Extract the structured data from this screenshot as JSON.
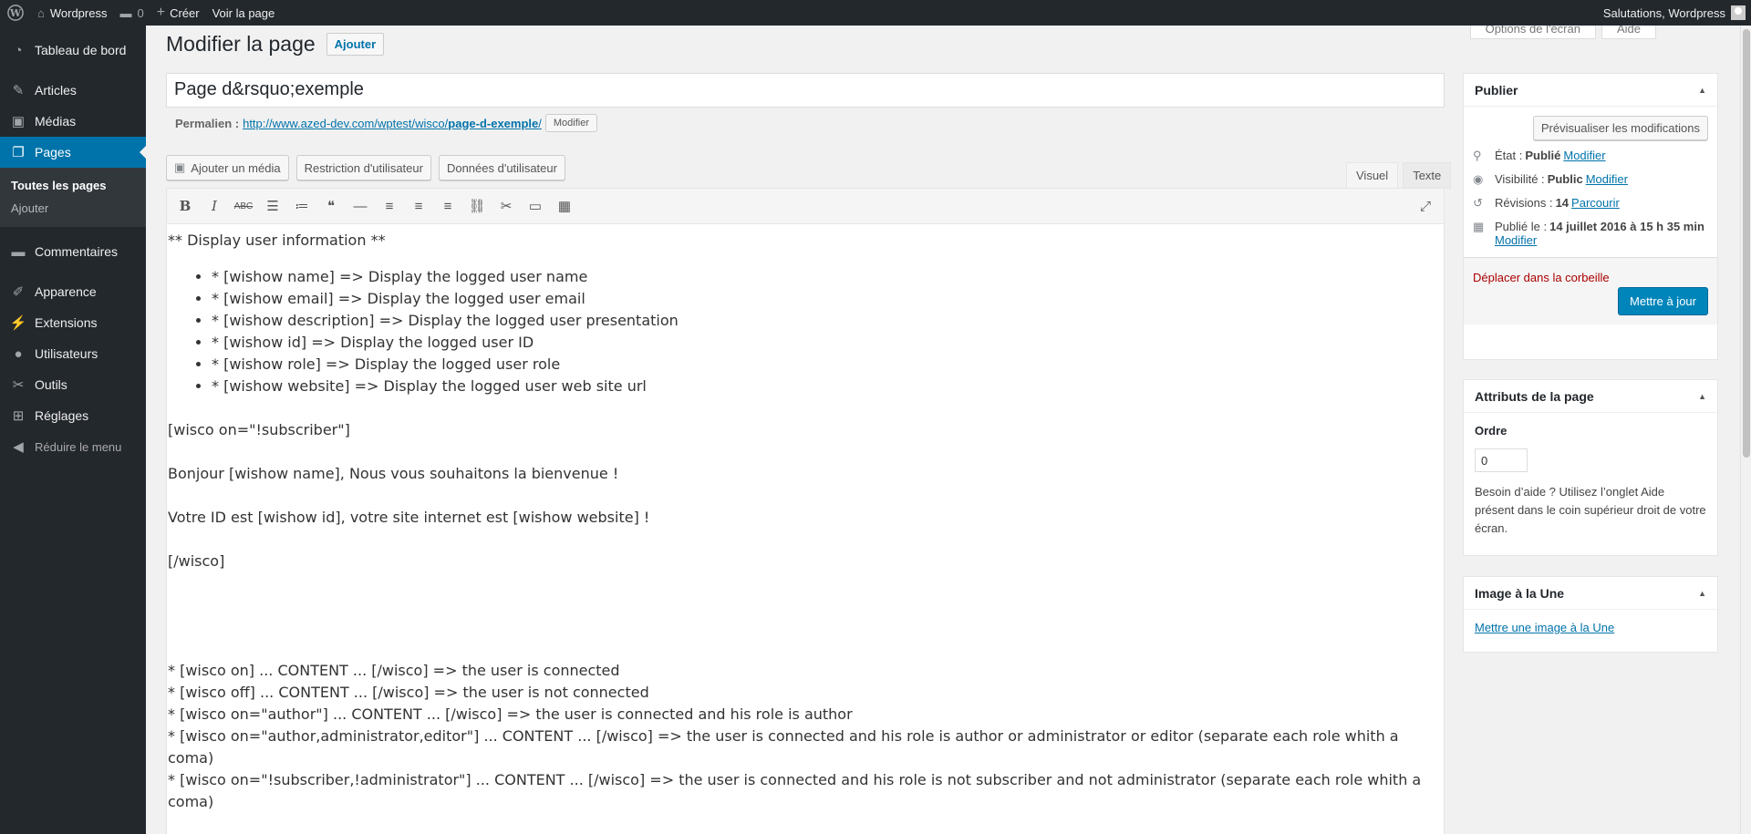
{
  "adminbar": {
    "site_name": "Wordpress",
    "comments_count": "0",
    "new_label": "Créer",
    "view_page": "Voir la page",
    "greeting": "Salutations, Wordpress"
  },
  "menu": {
    "dashboard": "Tableau de bord",
    "posts": "Articles",
    "media": "Médias",
    "pages": "Pages",
    "pages_all": "Toutes les pages",
    "pages_add": "Ajouter",
    "comments": "Commentaires",
    "appearance": "Apparence",
    "plugins": "Extensions",
    "users": "Utilisateurs",
    "tools": "Outils",
    "settings": "Réglages",
    "collapse": "Réduire le menu"
  },
  "screen_options": "Options de l'écran",
  "help_tab": "Aide",
  "page": {
    "heading": "Modifier la page",
    "add_button": "Ajouter",
    "title_value": "Page d&rsquo;exemple",
    "permalink_label": "Permalien :",
    "permalink_base": "http://www.azed-dev.com/wptest/wisco/",
    "permalink_slug": "page-d-exemple",
    "permalink_end": "/",
    "permalink_edit": "Modifier"
  },
  "editor": {
    "add_media": "Ajouter un média",
    "restriction": "Restriction d'utilisateur",
    "user_data": "Données d'utilisateur",
    "tab_visual": "Visuel",
    "tab_text": "Texte",
    "line1": "** Display user information **",
    "list": [
      "* [wishow name]  => Display the logged user name",
      "* [wishow email]  => Display the logged user email",
      "* [wishow description]  => Display the logged user presentation",
      "* [wishow id]  => Display the logged user ID",
      "* [wishow role]  => Display the logged user role",
      "* [wishow website]  => Display the logged user web site url"
    ],
    "line2": "[wisco on=\"!subscriber\"]",
    "line3": "Bonjour [wishow name], Nous vous souhaitons la bienvenue !",
    "line4": "Votre ID est [wishow id], votre site internet est [wishow website] !",
    "line5": "[/wisco]",
    "line6": "* [wisco on] ... CONTENT ... [/wisco]  => the user is connected",
    "line7": "* [wisco off] ... CONTENT ... [/wisco]  => the user is not connected",
    "line8": "* [wisco on=\"author\"] ... CONTENT ... [/wisco]  => the user is connected and his role is author",
    "line9": "* [wisco on=\"author,administrator,editor\"] ... CONTENT ... [/wisco]  => the user is connected and his role is author or administrator or editor (separate each role whith a coma)",
    "line10": "* [wisco on=\"!subscriber,!administrator\"] ... CONTENT ... [/wisco]  => the user is connected and his role is not subscriber and not administrator (separate each role whith a coma)"
  },
  "publish": {
    "title": "Publier",
    "preview": "Prévisualiser les modifications",
    "status_label": "État :",
    "status_value": "Publié",
    "status_edit": "Modifier",
    "visibility_label": "Visibilité :",
    "visibility_value": "Public",
    "visibility_edit": "Modifier",
    "revisions_label": "Révisions :",
    "revisions_value": "14",
    "revisions_link": "Parcourir",
    "published_label": "Publié le :",
    "published_value": "14 juillet 2016 à 15 h 35 min",
    "published_edit": "Modifier",
    "trash": "Déplacer dans la corbeille",
    "update": "Mettre à jour"
  },
  "attributes": {
    "title": "Attributs de la page",
    "order_label": "Ordre",
    "order_value": "0",
    "help": "Besoin d’aide ? Utilisez l’onglet Aide présent dans le coin supérieur droit de votre écran."
  },
  "featured": {
    "title": "Image à la Une",
    "link": "Mettre une image à la Une"
  },
  "colors": {
    "menu_bg": "#23282d",
    "accent": "#0073aa",
    "primary_button": "#0085ba",
    "trash": "#a00"
  }
}
